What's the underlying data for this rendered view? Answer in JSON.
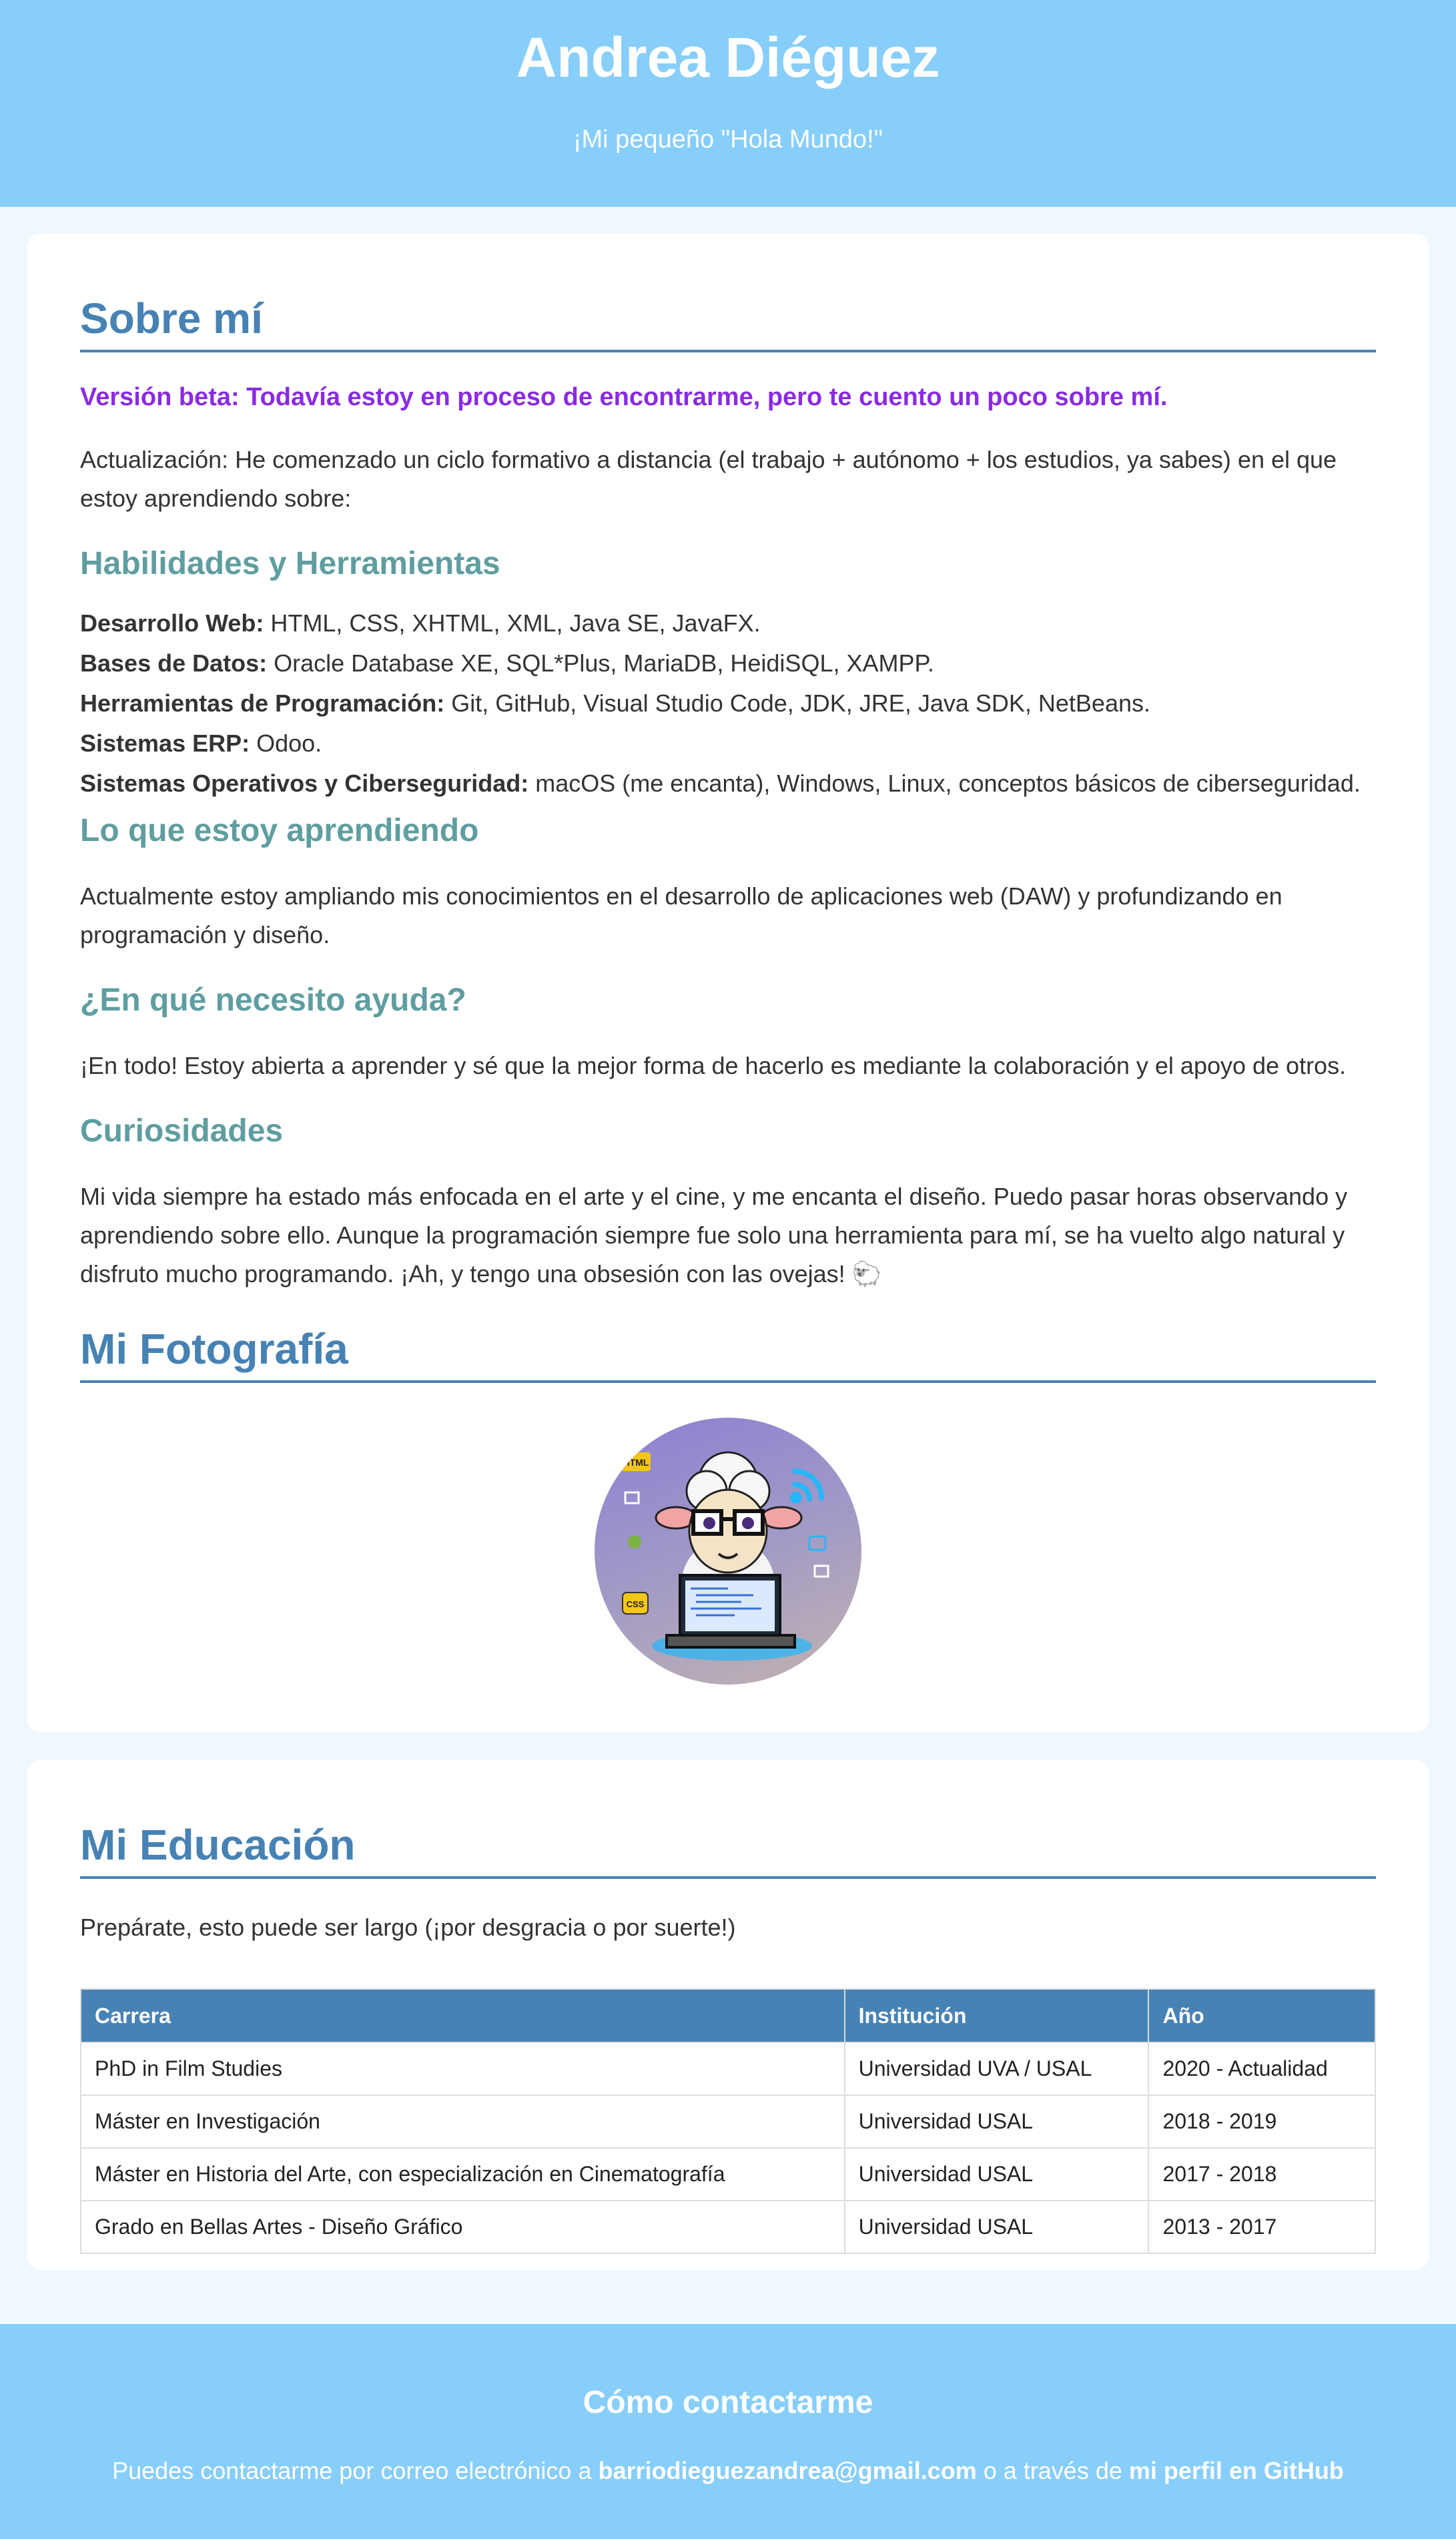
{
  "header": {
    "name": "Andrea Diéguez",
    "tagline": "¡Mi pequeño \"Hola Mundo!\""
  },
  "about": {
    "title": "Sobre mí",
    "beta_note": "Versión beta: Todavía estoy en proceso de encontrarme, pero te cuento un poco sobre mí.",
    "update_text": "Actualización: He comenzado un ciclo formativo a distancia (el trabajo + autónomo + los estudios, ya sabes) en el que estoy aprendiendo sobre:",
    "skills_title": "Habilidades y Herramientas",
    "skills": [
      {
        "label": "Desarrollo Web:",
        "value": " HTML, CSS, XHTML, XML, Java SE, JavaFX."
      },
      {
        "label": "Bases de Datos:",
        "value": " Oracle Database XE, SQL*Plus, MariaDB, HeidiSQL, XAMPP."
      },
      {
        "label": "Herramientas de Programación:",
        "value": " Git, GitHub, Visual Studio Code, JDK, JRE, Java SDK, NetBeans."
      },
      {
        "label": "Sistemas ERP:",
        "value": " Odoo."
      },
      {
        "label": "Sistemas Operativos y Ciberseguridad:",
        "value": " macOS (me encanta), Windows, Linux, conceptos básicos de ciberseguridad."
      }
    ],
    "learning_title": "Lo que estoy aprendiendo",
    "learning_text": "Actualmente estoy ampliando mis conocimientos en el desarrollo de aplicaciones web (DAW) y profundizando en programación y diseño.",
    "help_title": "¿En qué necesito ayuda?",
    "help_text": "¡En todo! Estoy abierta a aprender y sé que la mejor forma de hacerlo es mediante la colaboración y el apoyo de otros.",
    "curiosities_title": "Curiosidades",
    "curiosities_text": "Mi vida siempre ha estado más enfocada en el arte y el cine, y me encanta el diseño. Puedo pasar horas observando y aprendiendo sobre ello. Aunque la programación siempre fue solo una herramienta para mí, se ha vuelto algo natural y disfruto mucho programando. ¡Ah, y tengo una obsesión con las ovejas! 🐑",
    "photo_title": "Mi Fotografía"
  },
  "photo": {
    "badge_html": "HTML",
    "badge_css": "CSS"
  },
  "education": {
    "title": "Mi Educación",
    "intro": "Prepárate, esto puede ser largo (¡por desgracia o por suerte!)",
    "columns": [
      "Carrera",
      "Institución",
      "Año"
    ],
    "rows": [
      [
        "PhD in Film Studies",
        "Universidad UVA / USAL",
        "2020 - Actualidad"
      ],
      [
        "Máster en Investigación",
        "Universidad USAL",
        "2018 - 2019"
      ],
      [
        "Máster en Historia del Arte, con especialización en Cinematografía",
        "Universidad USAL",
        "2017 - 2018"
      ],
      [
        "Grado en Bellas Artes - Diseño Gráfico",
        "Universidad USAL",
        "2013 - 2017"
      ]
    ]
  },
  "footer": {
    "title": "Cómo contactarme",
    "text_before": "Puedes contactarme por correo electrónico a ",
    "email": "barriodieguezandrea@gmail.com",
    "text_middle": " o a través de ",
    "github_link": "mi perfil en GitHub"
  },
  "colors": {
    "header_bg": "#87cefa",
    "heading": "#4682b4",
    "subheading": "#5f9ea0",
    "beta": "#8a2be2"
  }
}
